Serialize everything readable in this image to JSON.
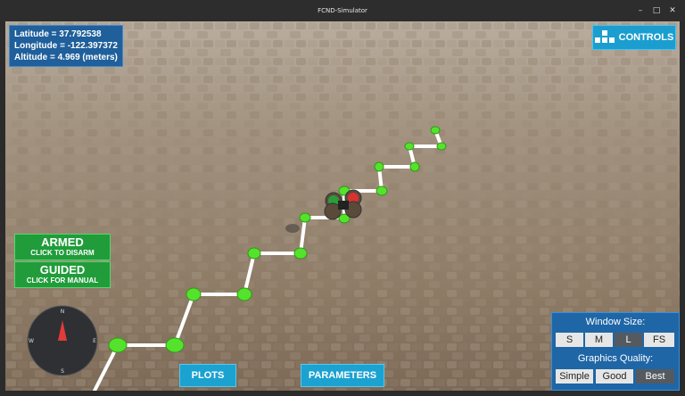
{
  "window": {
    "title": "FCND-Simulator",
    "minimize": "–",
    "maximize": "□",
    "close": "✕"
  },
  "telemetry": {
    "latitude": "Latitude = 37.792538",
    "longitude": "Longitude = -122.397372",
    "altitude": "Altitude = 4.969 (meters)"
  },
  "controls": {
    "label": "CONTROLS",
    "icon": "grid-icon"
  },
  "armed": {
    "title": "ARMED",
    "subtitle": "CLICK TO DISARM"
  },
  "guided": {
    "title": "GUIDED",
    "subtitle": "CLICK FOR MANUAL"
  },
  "bottom": {
    "plots": "PLOTS",
    "parameters": "PARAMETERS"
  },
  "compass": {
    "n": "N",
    "s": "S",
    "e": "E",
    "w": "W"
  },
  "settings": {
    "window_size_label": "Window Size:",
    "sizes": [
      "S",
      "M",
      "L",
      "FS"
    ],
    "selected_size": "L",
    "quality_label": "Graphics Quality:",
    "qualities": [
      "Simple",
      "Good",
      "Best"
    ],
    "selected_quality": "Best"
  },
  "colors": {
    "accent": "#1b9ecf",
    "armed": "#219c3a",
    "panel": "#1f66a6",
    "path": "#ffffff",
    "waypoint": "#55e22c"
  }
}
